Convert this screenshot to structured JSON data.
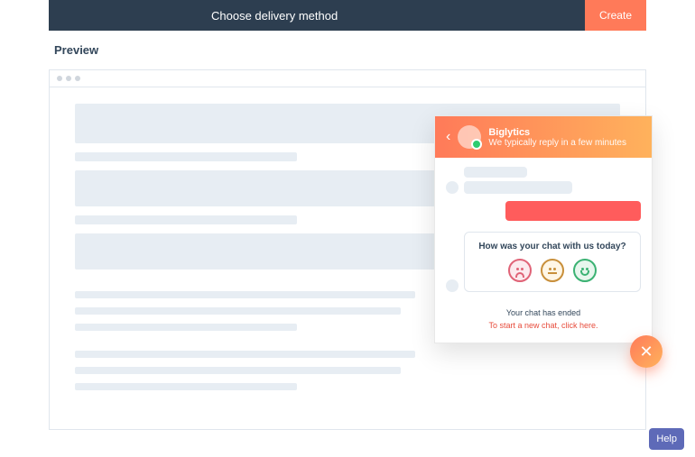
{
  "topbar": {
    "title": "Choose delivery method",
    "create_label": "Create"
  },
  "preview_label": "Preview",
  "chat": {
    "brand": "Biglytics",
    "reply_time": "We typically reply in a few minutes",
    "feedback_question": "How was your chat with us today?",
    "ended_text": "Your chat has ended",
    "new_chat_link": "To start a new chat, click here."
  },
  "help_label": "Help"
}
